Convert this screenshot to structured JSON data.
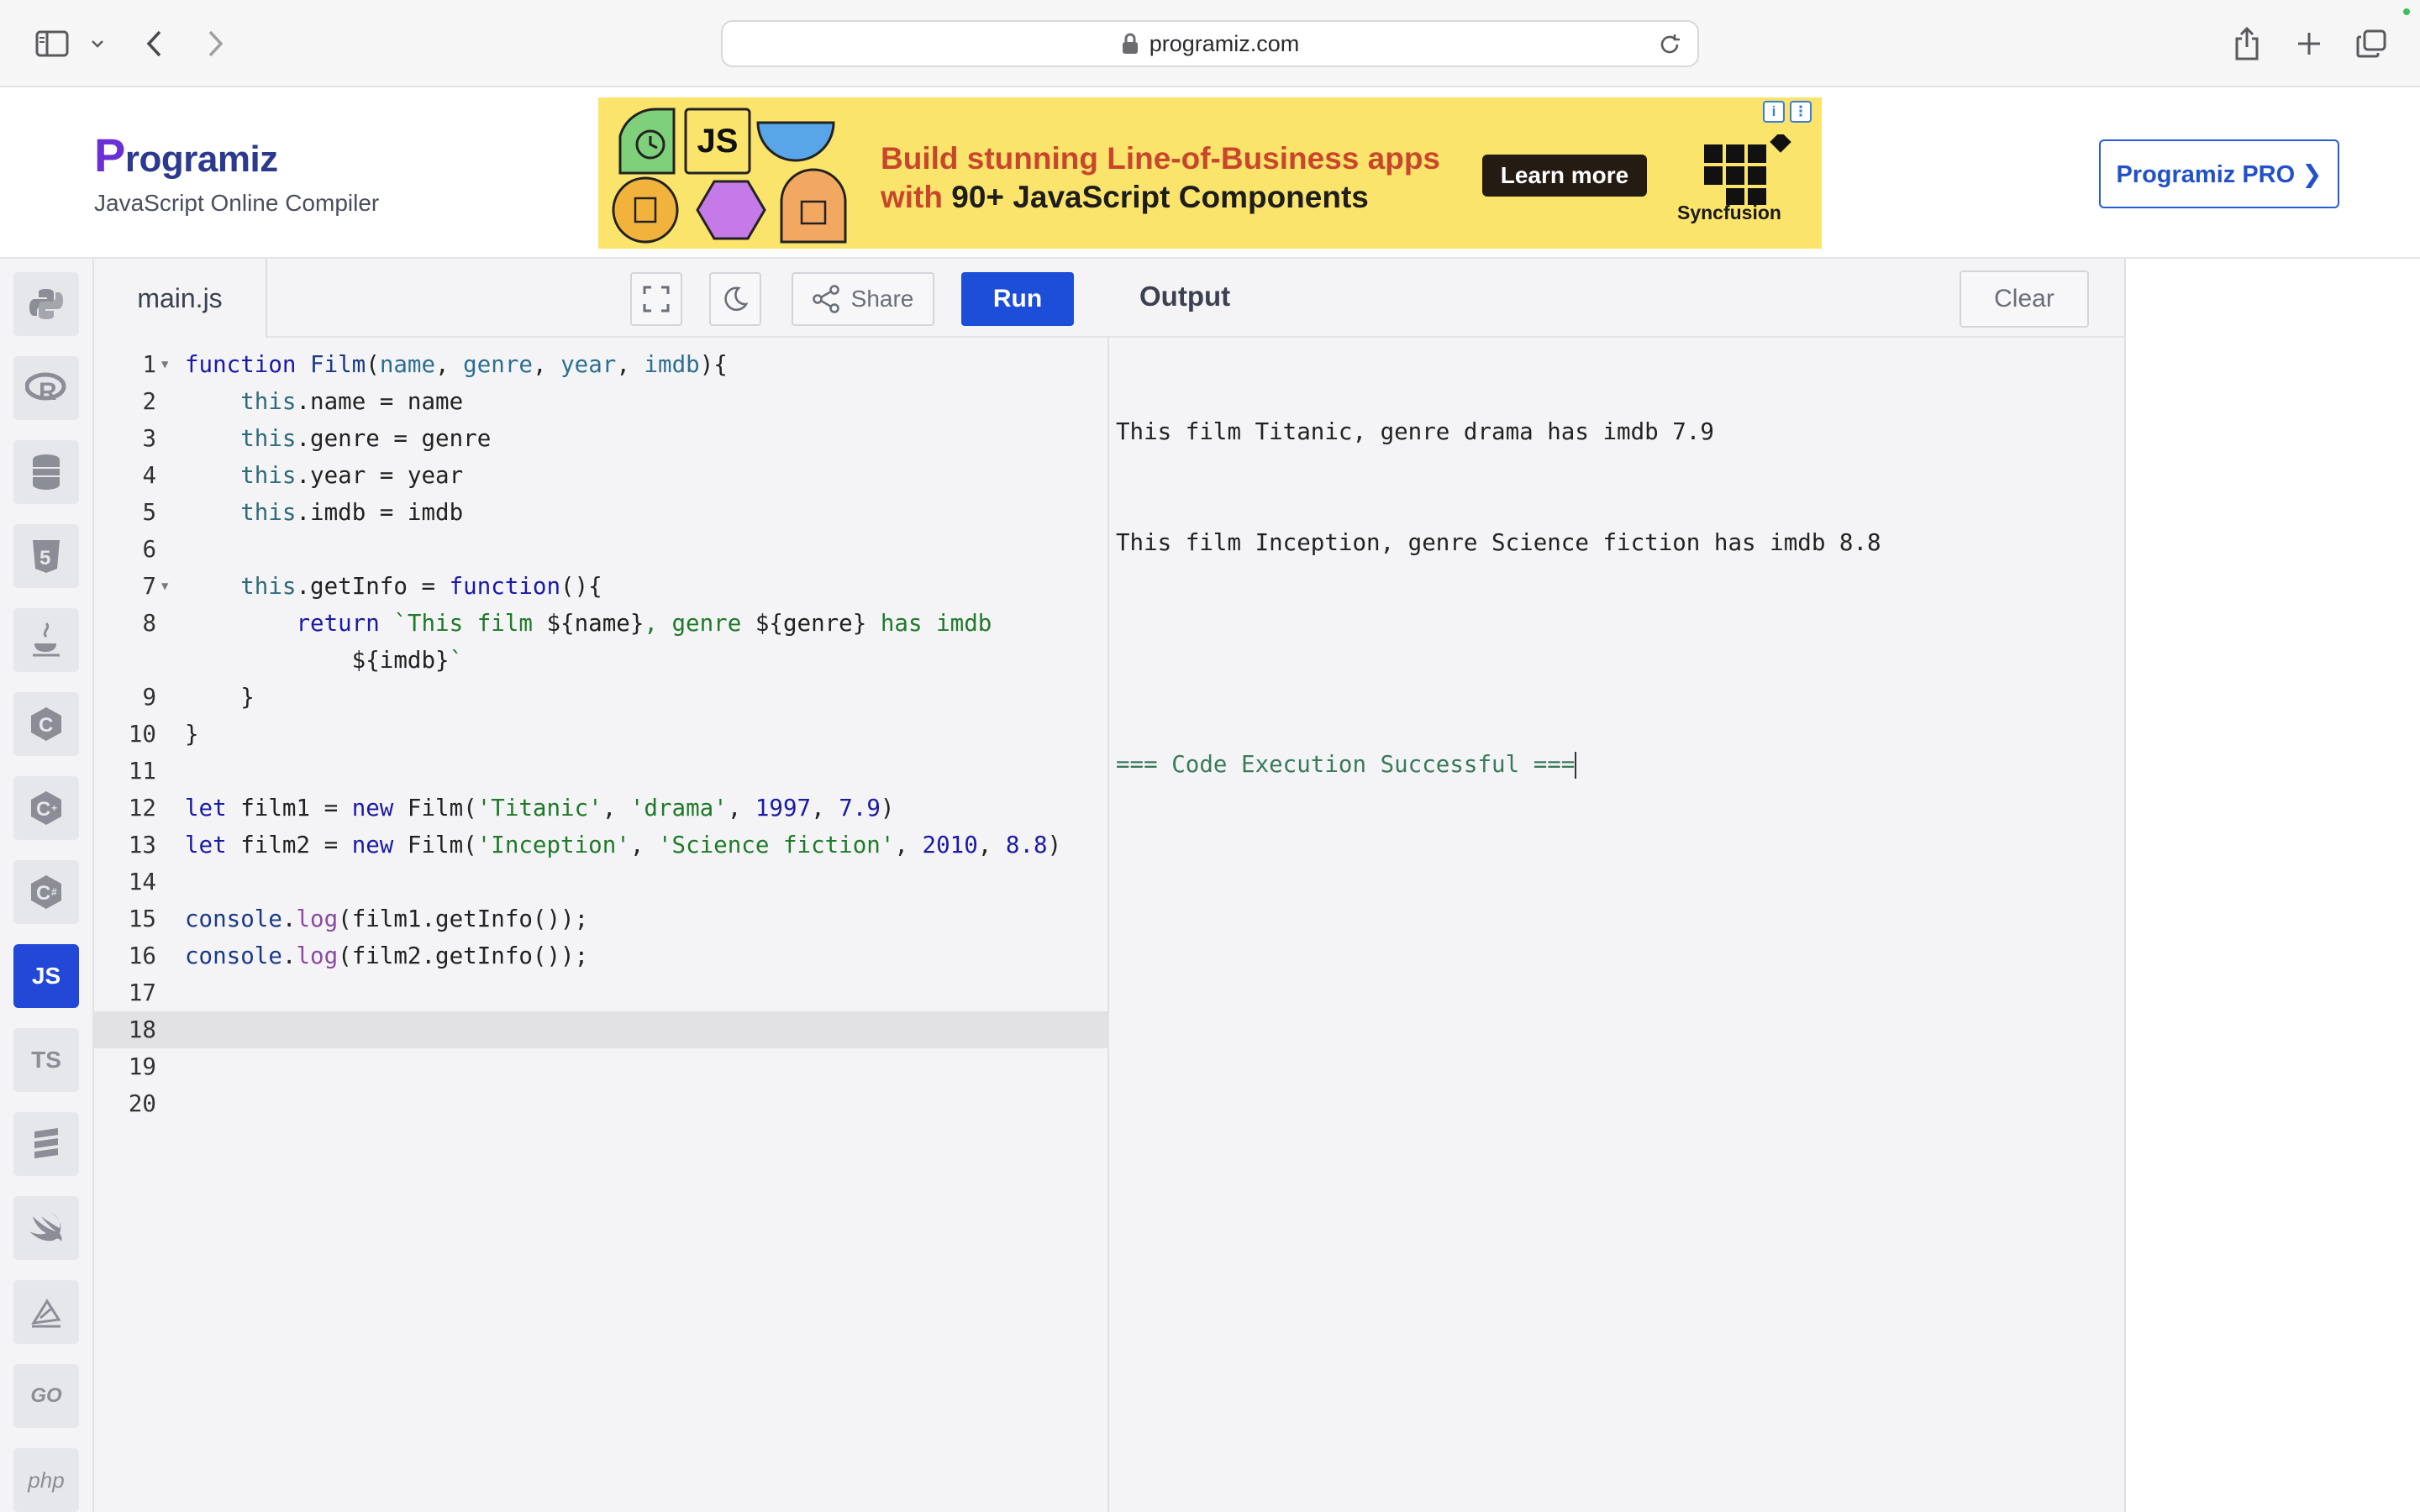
{
  "browser": {
    "url": "programiz.com"
  },
  "header": {
    "logo_text": "rogramiz",
    "logo_initial": "P",
    "tagline": "JavaScript Online Compiler",
    "pro_button": "Programiz PRO ❯"
  },
  "ad": {
    "headline_line1": "Build stunning Line-of-Business apps",
    "headline_line2_prefix": "with ",
    "headline_line2_bold": "90+ JavaScript Components",
    "cta": "Learn more",
    "brand": "Syncfusion",
    "js_badge": "JS"
  },
  "rail": {
    "items": [
      {
        "name": "python",
        "label": "🐍"
      },
      {
        "name": "r",
        "label": "R"
      },
      {
        "name": "sql",
        "label": "≡"
      },
      {
        "name": "html",
        "label": "5"
      },
      {
        "name": "java",
        "label": "☕"
      },
      {
        "name": "c",
        "label": "C"
      },
      {
        "name": "cpp",
        "label": "C"
      },
      {
        "name": "csharp",
        "label": "C"
      },
      {
        "name": "js",
        "label": "JS"
      },
      {
        "name": "ts",
        "label": "TS"
      },
      {
        "name": "sql2",
        "label": "≣"
      },
      {
        "name": "swift",
        "label": "◆"
      },
      {
        "name": "kotlin",
        "label": "◩"
      },
      {
        "name": "go",
        "label": "GO"
      },
      {
        "name": "php",
        "label": "php"
      }
    ]
  },
  "editor": {
    "file_name": "main.js",
    "share_label": "Share",
    "run_label": "Run",
    "line_numbers": [
      "1",
      "2",
      "3",
      "4",
      "5",
      "6",
      "7",
      "8",
      "",
      "9",
      "10",
      "11",
      "12",
      "13",
      "14",
      "15",
      "16",
      "17",
      "18",
      "19",
      "20"
    ]
  },
  "output": {
    "title": "Output",
    "clear_label": "Clear",
    "lines": [
      "This film Titanic, genre drama has imdb 7.9",
      "This film Inception, genre Science fiction has imdb 8.8",
      "",
      "=== Code Execution Successful ==="
    ]
  },
  "colors": {
    "accent": "#1d4ed8",
    "rail_active": "#2348d8",
    "ad_bg": "#fbe46b"
  }
}
